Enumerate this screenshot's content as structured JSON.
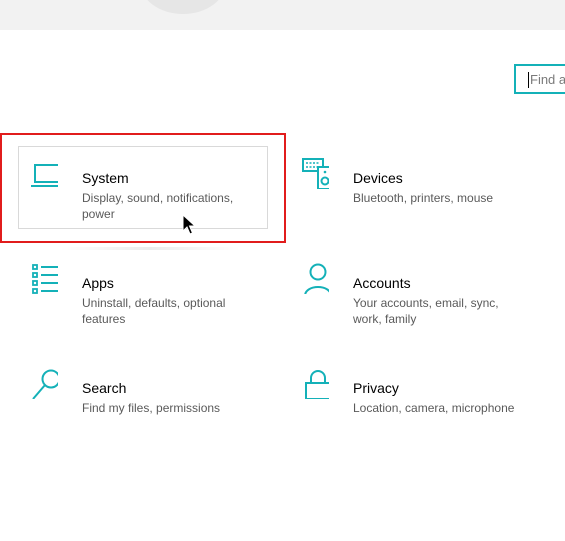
{
  "search": {
    "placeholder": "Find a"
  },
  "categories": [
    {
      "title": "System",
      "description": "Display, sound, notifications, power",
      "icon": "laptop-icon"
    },
    {
      "title": "Devices",
      "description": "Bluetooth, printers, mouse",
      "icon": "keyboard-speaker-icon"
    },
    {
      "title": "Apps",
      "description": "Uninstall, defaults, optional features",
      "icon": "apps-list-icon"
    },
    {
      "title": "Accounts",
      "description": "Your accounts, email, sync, work, family",
      "icon": "person-icon"
    },
    {
      "title": "Search",
      "description": "Find my files, permissions",
      "icon": "magnifier-icon"
    },
    {
      "title": "Privacy",
      "description": "Location, camera, microphone",
      "icon": "lock-icon"
    }
  ],
  "colors": {
    "accent": "#14b1b8",
    "highlight": "#e11c1c",
    "top_band": "#f2f2f2"
  }
}
